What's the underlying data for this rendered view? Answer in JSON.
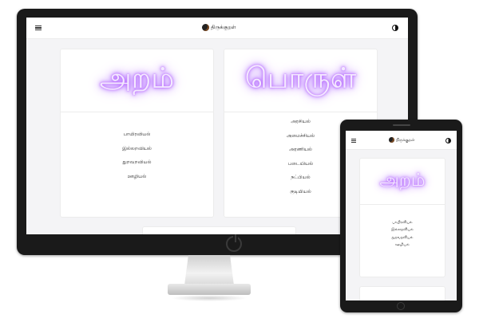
{
  "app": {
    "title": "திருக்குறள்"
  },
  "sections": [
    {
      "title": "அறம்",
      "chapters": [
        "பாயிரவியல்",
        "இல்லறவியல்",
        "துறவறவியல்",
        "ஊழியல்"
      ]
    },
    {
      "title": "பொருள்",
      "chapters": [
        "அரசியல்",
        "அமைச்சியல்",
        "அரணியல்",
        "படையியல்",
        "நட்பியல்",
        "குடியியல்"
      ]
    }
  ],
  "colors": {
    "glow": "#a24dff",
    "glow_light": "#f4eaff",
    "page_bg": "#f4f4f6",
    "device": "#1a1a1a"
  },
  "icons": {
    "menu": "hamburger-menu-icon",
    "logo": "thiruvalluvar-logo-icon",
    "theme": "half-moon-theme-icon",
    "power": "power-icon"
  }
}
